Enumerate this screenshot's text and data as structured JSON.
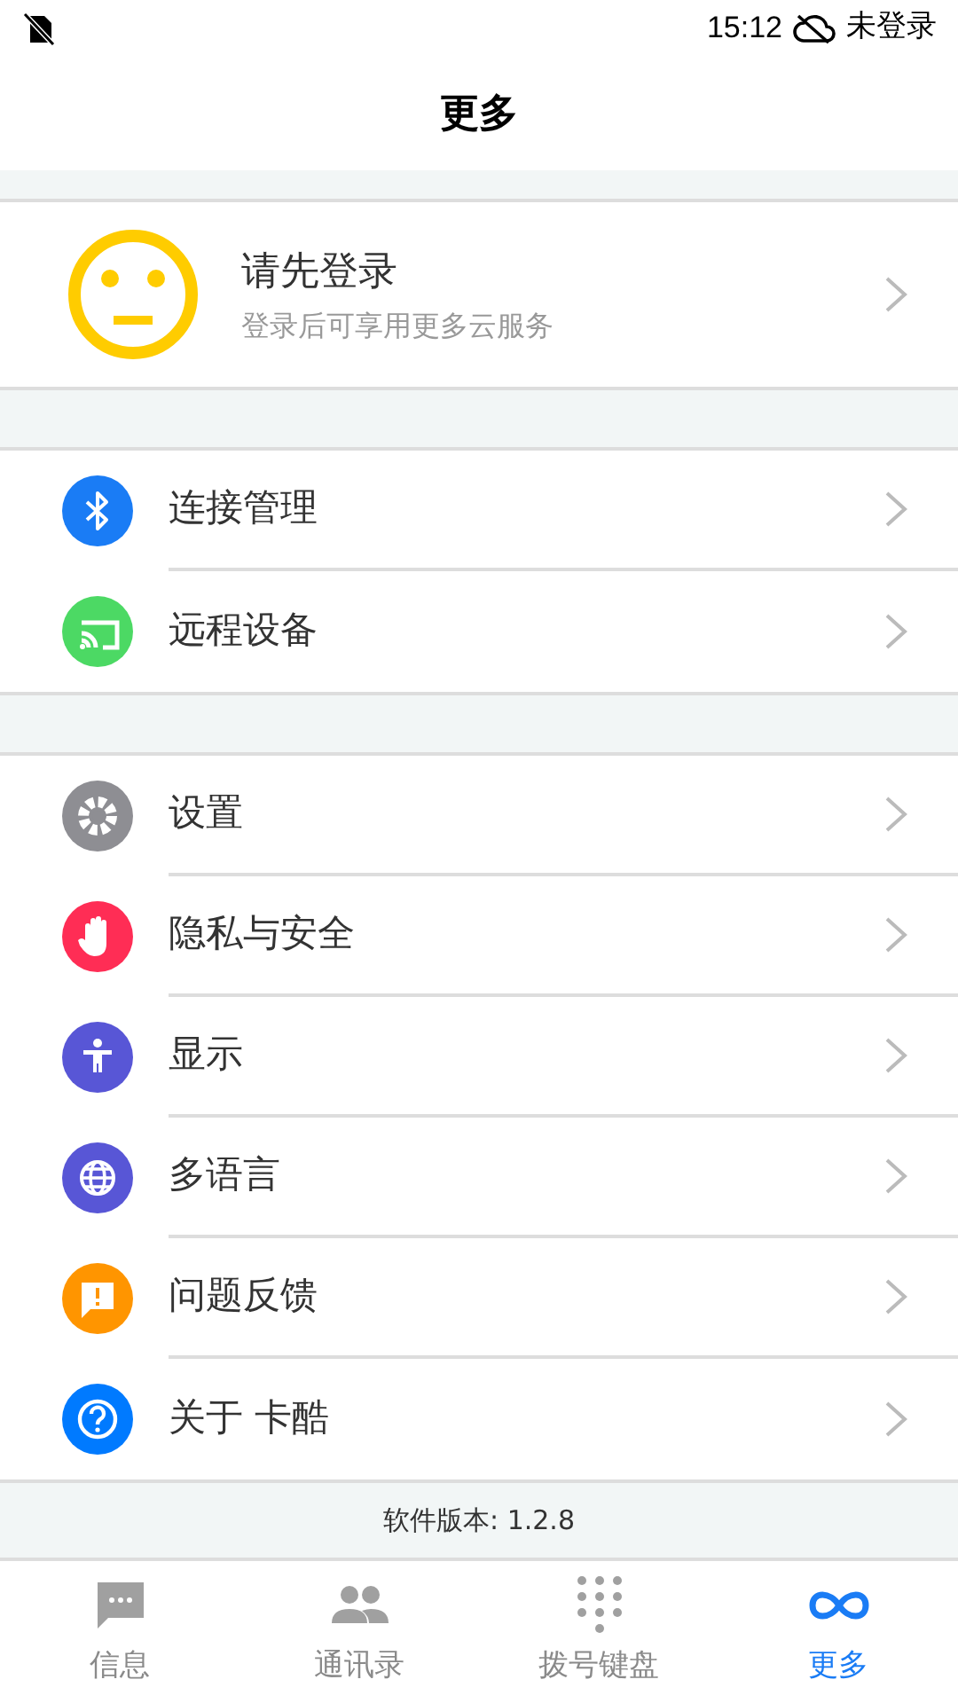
{
  "status_bar": {
    "time": "15:12",
    "account": "未登录"
  },
  "title": "更多",
  "profile": {
    "name": "请先登录",
    "subtitle": "登录后可享用更多云服务"
  },
  "groups": [
    [
      {
        "label": "连接管理",
        "color": "#1a7cf5"
      },
      {
        "label": "远程设备",
        "color": "#4cd964"
      }
    ],
    [
      {
        "label": "设置",
        "color": "#8e8e93"
      },
      {
        "label": "隐私与安全",
        "color": "#ff2d55"
      },
      {
        "label": "显示",
        "color": "#5856d6"
      },
      {
        "label": "多语言",
        "color": "#5856d6"
      },
      {
        "label": "问题反馈",
        "color": "#ff9500"
      },
      {
        "label": "关于 卡酷",
        "color": "#007aff"
      }
    ]
  ],
  "version": "软件版本: 1.2.8",
  "tabs": [
    {
      "label": "信息",
      "selected": false
    },
    {
      "label": "通讯录",
      "selected": false
    },
    {
      "label": "拨号键盘",
      "selected": false
    },
    {
      "label": "更多",
      "selected": true
    }
  ]
}
